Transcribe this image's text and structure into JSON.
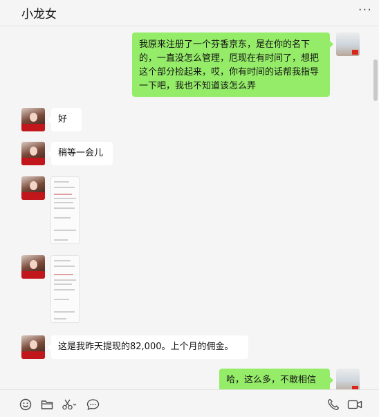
{
  "window": {
    "title": "小龙女",
    "more_label": "···"
  },
  "messages": [
    {
      "from": "me",
      "type": "text",
      "text": "我原来注册了一个芬香京东，是在你的名下的，一直没怎么管理，厄现在有时间了，想把这个部分捡起来，哎，你有时间的话帮我指导一下吧，我也不知道该怎么弄"
    },
    {
      "from": "other",
      "type": "text",
      "text": "好"
    },
    {
      "from": "other",
      "type": "text",
      "text": "稍等一会儿"
    },
    {
      "from": "other",
      "type": "image"
    },
    {
      "from": "other",
      "type": "image"
    },
    {
      "from": "other",
      "type": "text",
      "text": "这是我昨天提现的82,000。上个月的佣金。"
    },
    {
      "from": "me",
      "type": "text",
      "text": "哈，这么多，不敢相信"
    }
  ],
  "toolbar": {
    "icons": [
      "emoji-icon",
      "folder-icon",
      "scissors-icon",
      "chat-bubble-icon"
    ],
    "right_icons": [
      "phone-icon",
      "video-icon"
    ]
  },
  "colors": {
    "out_bubble": "#95ec69",
    "in_bubble": "#ffffff",
    "background": "#f5f5f5",
    "avatar_banner": "#c0161c"
  }
}
